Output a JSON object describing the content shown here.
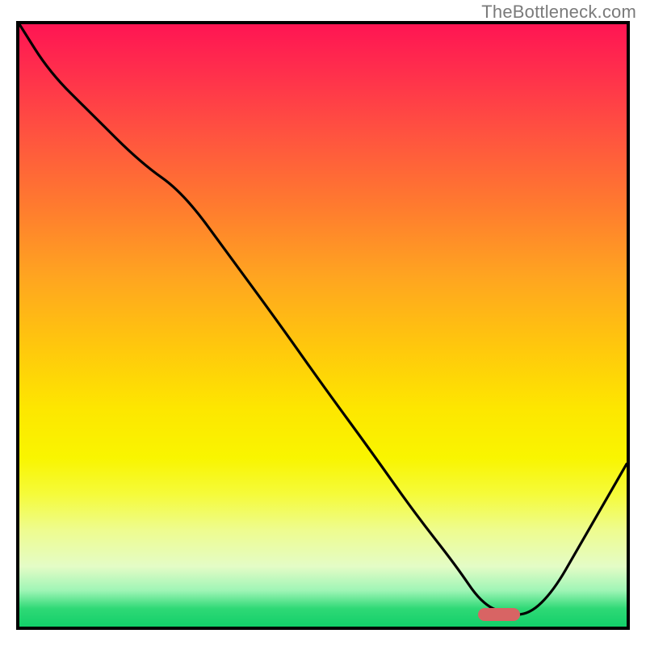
{
  "watermark": {
    "text": "TheBottleneck.com"
  },
  "colors": {
    "frame": "#000000",
    "curve": "#000000",
    "marker": "#d86464",
    "gradient_stops": [
      "#ff1553",
      "#ff2f4c",
      "#ff5240",
      "#ff7a2f",
      "#ffa520",
      "#ffc90c",
      "#fde700",
      "#f9f500",
      "#f5fb3a",
      "#eefc8f",
      "#e4fcc6",
      "#9ff5b6",
      "#2fd976",
      "#12cf69"
    ]
  },
  "chart_data": {
    "type": "line",
    "title": "",
    "xlabel": "",
    "ylabel": "",
    "xlim": [
      0,
      100
    ],
    "ylim": [
      0,
      100
    ],
    "legend": false,
    "grid": false,
    "touch_marker": {
      "x": 79,
      "y": 2,
      "width_pct": 7
    },
    "series": [
      {
        "name": "bottleneck-curve",
        "x": [
          0,
          5,
          12,
          20,
          27,
          35,
          43,
          50,
          58,
          65,
          72,
          76,
          80,
          84,
          88,
          92,
          96,
          100
        ],
        "y": [
          100,
          92,
          85,
          77,
          72,
          61,
          50,
          40,
          29,
          19,
          10,
          4,
          2,
          2,
          6,
          13,
          20,
          27
        ]
      }
    ],
    "notes": "x and y are percentages of the plot interior (0=left/bottom, 100=right/top). Values estimated visually from the screenshot; the curve descends from top-left, has a slight elbow near x≈25, reaches a minimum around x≈79 (a short flat near the bottom rail with a small red capsule marker), then rises toward top-right."
  }
}
